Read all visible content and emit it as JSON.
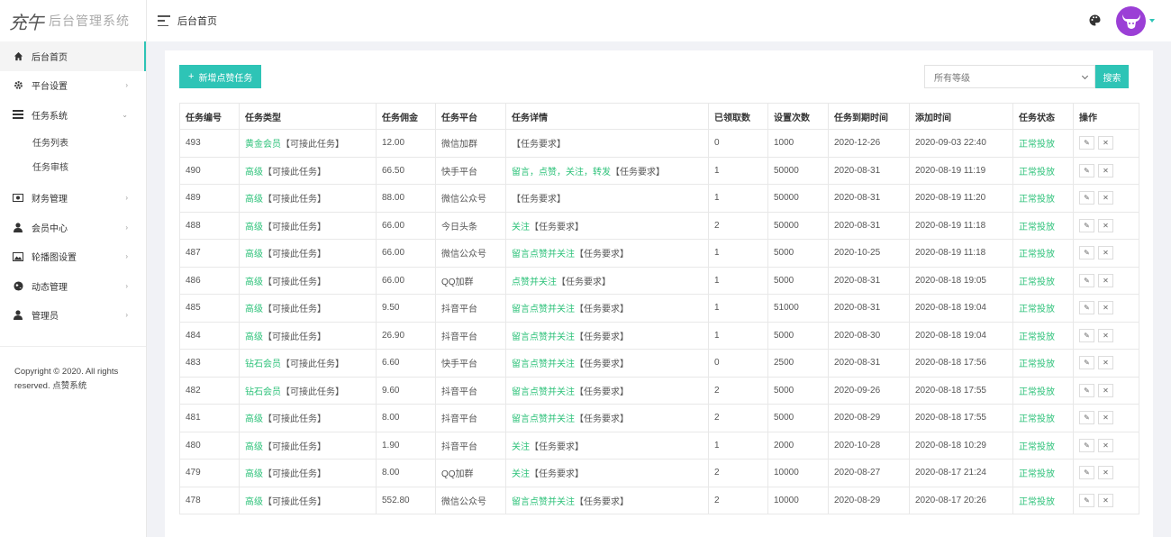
{
  "brand": {
    "mark": "充午",
    "title": "后台管理系统"
  },
  "header": {
    "title": "后台首页"
  },
  "colors": {
    "accent": "#2ec4b6",
    "status_green": "#2ec27a",
    "avatar_bg": "#9b3fd6"
  },
  "sidebar": {
    "items": [
      {
        "label": "后台首页",
        "icon": "home-icon",
        "active": true
      },
      {
        "label": "平台设置",
        "icon": "gear-icon",
        "chevron": "›"
      },
      {
        "label": "任务系统",
        "icon": "tasks-icon",
        "chevron": "⌄"
      },
      {
        "label": "财务管理",
        "icon": "money-icon",
        "chevron": "›"
      },
      {
        "label": "会员中心",
        "icon": "user-icon",
        "chevron": "›"
      },
      {
        "label": "轮播图设置",
        "icon": "image-icon",
        "chevron": "›"
      },
      {
        "label": "动态管理",
        "icon": "globe-icon",
        "chevron": "›"
      },
      {
        "label": "管理员",
        "icon": "admin-icon",
        "chevron": "›"
      }
    ],
    "sub_items": [
      "任务列表",
      "任务审核"
    ],
    "copyright": "Copyright © 2020. All rights reserved. 点赞系统"
  },
  "toolbar": {
    "add_label": "新增点赞任务",
    "add_icon": "+",
    "select_value": "所有等级",
    "search_label": "搜索"
  },
  "table": {
    "headers": [
      "任务编号",
      "任务类型",
      "任务佣金",
      "任务平台",
      "任务详情",
      "已领取数",
      "设置次数",
      "任务到期时间",
      "添加时间",
      "任务状态",
      "操作"
    ],
    "rows": [
      {
        "id": "493",
        "type_tag": "黄金会员",
        "type_rest": "【可接此任务】",
        "commission": "12.00",
        "platform": "微信加群",
        "detail_tag": "",
        "detail_rest": "【任务要求】",
        "claimed": "0",
        "count": "1000",
        "expire": "2020-12-26",
        "added": "2020-09-03 22:40",
        "status": "正常投放"
      },
      {
        "id": "490",
        "type_tag": "高级",
        "type_rest": "【可接此任务】",
        "commission": "66.50",
        "platform": "快手平台",
        "detail_tag": "留言，点赞，关注，转发",
        "detail_rest": "【任务要求】",
        "claimed": "1",
        "count": "50000",
        "expire": "2020-08-31",
        "added": "2020-08-19 11:19",
        "status": "正常投放"
      },
      {
        "id": "489",
        "type_tag": "高级",
        "type_rest": "【可接此任务】",
        "commission": "88.00",
        "platform": "微信公众号",
        "detail_tag": "",
        "detail_rest": "【任务要求】",
        "claimed": "1",
        "count": "50000",
        "expire": "2020-08-31",
        "added": "2020-08-19 11:20",
        "status": "正常投放"
      },
      {
        "id": "488",
        "type_tag": "高级",
        "type_rest": "【可接此任务】",
        "commission": "66.00",
        "platform": "今日头条",
        "detail_tag": "关注",
        "detail_rest": "【任务要求】",
        "claimed": "2",
        "count": "50000",
        "expire": "2020-08-31",
        "added": "2020-08-19 11:18",
        "status": "正常投放"
      },
      {
        "id": "487",
        "type_tag": "高级",
        "type_rest": "【可接此任务】",
        "commission": "66.00",
        "platform": "微信公众号",
        "detail_tag": "留言点赞并关注",
        "detail_rest": "【任务要求】",
        "claimed": "1",
        "count": "5000",
        "expire": "2020-10-25",
        "added": "2020-08-19 11:18",
        "status": "正常投放"
      },
      {
        "id": "486",
        "type_tag": "高级",
        "type_rest": "【可接此任务】",
        "commission": "66.00",
        "platform": "QQ加群",
        "detail_tag": "点赞并关注",
        "detail_rest": "【任务要求】",
        "claimed": "1",
        "count": "5000",
        "expire": "2020-08-31",
        "added": "2020-08-18 19:05",
        "status": "正常投放"
      },
      {
        "id": "485",
        "type_tag": "高级",
        "type_rest": "【可接此任务】",
        "commission": "9.50",
        "platform": "抖音平台",
        "detail_tag": "留言点赞并关注",
        "detail_rest": "【任务要求】",
        "claimed": "1",
        "count": "51000",
        "expire": "2020-08-31",
        "added": "2020-08-18 19:04",
        "status": "正常投放"
      },
      {
        "id": "484",
        "type_tag": "高级",
        "type_rest": "【可接此任务】",
        "commission": "26.90",
        "platform": "抖音平台",
        "detail_tag": "留言点赞并关注",
        "detail_rest": "【任务要求】",
        "claimed": "1",
        "count": "5000",
        "expire": "2020-08-30",
        "added": "2020-08-18 19:04",
        "status": "正常投放"
      },
      {
        "id": "483",
        "type_tag": "钻石会员",
        "type_rest": "【可接此任务】",
        "commission": "6.60",
        "platform": "快手平台",
        "detail_tag": "留言点赞并关注",
        "detail_rest": "【任务要求】",
        "claimed": "0",
        "count": "2500",
        "expire": "2020-08-31",
        "added": "2020-08-18 17:56",
        "status": "正常投放"
      },
      {
        "id": "482",
        "type_tag": "钻石会员",
        "type_rest": "【可接此任务】",
        "commission": "9.60",
        "platform": "抖音平台",
        "detail_tag": "留言点赞并关注",
        "detail_rest": "【任务要求】",
        "claimed": "2",
        "count": "5000",
        "expire": "2020-09-26",
        "added": "2020-08-18 17:55",
        "status": "正常投放"
      },
      {
        "id": "481",
        "type_tag": "高级",
        "type_rest": "【可接此任务】",
        "commission": "8.00",
        "platform": "抖音平台",
        "detail_tag": "留言点赞并关注",
        "detail_rest": "【任务要求】",
        "claimed": "2",
        "count": "5000",
        "expire": "2020-08-29",
        "added": "2020-08-18 17:55",
        "status": "正常投放"
      },
      {
        "id": "480",
        "type_tag": "高级",
        "type_rest": "【可接此任务】",
        "commission": "1.90",
        "platform": "抖音平台",
        "detail_tag": "关注",
        "detail_rest": "【任务要求】",
        "claimed": "1",
        "count": "2000",
        "expire": "2020-10-28",
        "added": "2020-08-18 10:29",
        "status": "正常投放"
      },
      {
        "id": "479",
        "type_tag": "高级",
        "type_rest": "【可接此任务】",
        "commission": "8.00",
        "platform": "QQ加群",
        "detail_tag": "关注",
        "detail_rest": "【任务要求】",
        "claimed": "2",
        "count": "10000",
        "expire": "2020-08-27",
        "added": "2020-08-17 21:24",
        "status": "正常投放"
      },
      {
        "id": "478",
        "type_tag": "高级",
        "type_rest": "【可接此任务】",
        "commission": "552.80",
        "platform": "微信公众号",
        "detail_tag": "留言点赞并关注",
        "detail_rest": "【任务要求】",
        "claimed": "2",
        "count": "10000",
        "expire": "2020-08-29",
        "added": "2020-08-17 20:26",
        "status": "正常投放"
      }
    ],
    "op_icons": {
      "edit": "edit-icon",
      "delete": "close-icon"
    },
    "op_glyphs": {
      "edit": "✎",
      "delete": "✕"
    }
  }
}
